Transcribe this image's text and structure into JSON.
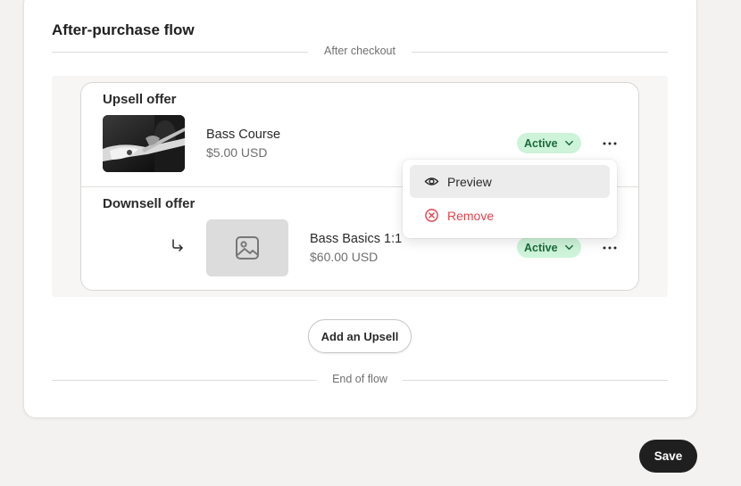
{
  "section": {
    "title": "After-purchase flow"
  },
  "dividers": {
    "top": "After checkout",
    "bottom": "End of flow"
  },
  "upsell": {
    "heading": "Upsell offer",
    "product_name": "Bass Course",
    "price": "$5.00 USD",
    "status": "Active",
    "image": "guitar-photo"
  },
  "downsell": {
    "heading": "Downsell offer",
    "product_name": "Bass Basics 1:1",
    "price": "$60.00 USD",
    "status": "Active",
    "image": "image-placeholder-icon"
  },
  "menu": {
    "items": [
      {
        "label": "Preview",
        "icon": "eye-icon"
      },
      {
        "label": "Remove",
        "icon": "x-circle-icon",
        "color": "#e0444b"
      }
    ]
  },
  "actions": {
    "add_upsell": "Add an Upsell",
    "save": "Save"
  },
  "colors": {
    "active_bg": "#cdf3d9",
    "active_text": "#1c6a3b",
    "danger": "#e0444b",
    "primary_button": "#1f1f1f"
  }
}
